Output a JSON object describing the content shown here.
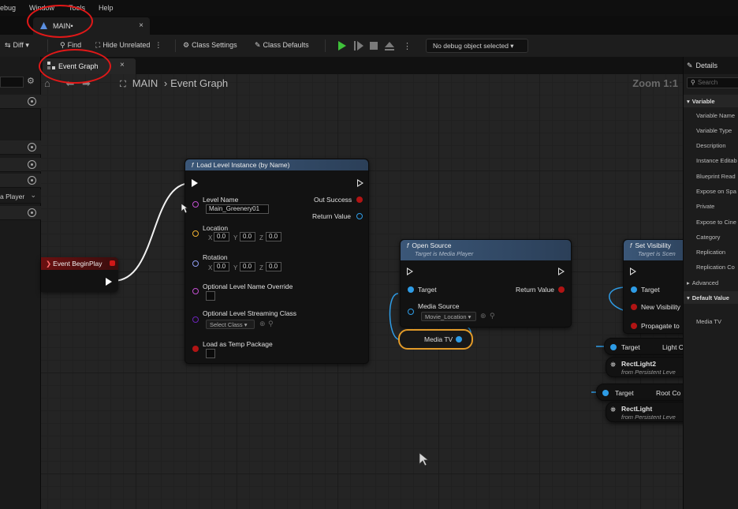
{
  "menu": {
    "items": [
      "ebug",
      "Window",
      "Tools",
      "Help"
    ]
  },
  "doc_tab": {
    "label": "MAIN•",
    "close": "×"
  },
  "toolbar": {
    "diff": "Diff ▾",
    "find": "Find",
    "hide_unrelated": "Hide Unrelated",
    "class_settings": "Class Settings",
    "class_defaults": "Class Defaults",
    "debug_select": "No debug object selected ▾"
  },
  "graph_tab": {
    "label": "Event Graph",
    "close": "×"
  },
  "breadcrumb": {
    "root": "MAIN",
    "separator": "›",
    "current": "Event Graph"
  },
  "zoom": "Zoom 1:1",
  "left_panel": {
    "partial_label": "a Player"
  },
  "event_node": {
    "title": "Event BeginPlay"
  },
  "load_level_node": {
    "title": "Load Level Instance (by Name)",
    "level_name_label": "Level Name",
    "level_name_value": "Main_Greenery01",
    "location_label": "Location",
    "rotation_label": "Rotation",
    "axis_x": "X",
    "axis_y": "Y",
    "axis_z": "Z",
    "loc_x": "0.0",
    "loc_y": "0.0",
    "loc_z": "0.0",
    "rot_x": "0.0",
    "rot_y": "0.0",
    "rot_z": "0.0",
    "override_label": "Optional Level Name Override",
    "streaming_label": "Optional Level Streaming Class",
    "streaming_value": "Select Class ▾",
    "temp_label": "Load as Temp Package",
    "out_success": "Out Success",
    "return_value": "Return Value"
  },
  "open_source_node": {
    "title": "Open Source",
    "subtitle": "Target is Media Player",
    "target": "Target",
    "media_source": "Media Source",
    "media_source_value": "Movie_Location ▾",
    "return_value": "Return Value"
  },
  "media_tv_var": {
    "label": "Media TV"
  },
  "set_visibility_node": {
    "title": "Set Visibility",
    "subtitle": "Target is Scen",
    "target": "Target",
    "new_visibility": "New Visibility",
    "propagate": "Propagate to"
  },
  "light_nodes": [
    {
      "target": "Target",
      "prop": "Light C",
      "name": "RectLight2",
      "from": "from Persistent Leve"
    },
    {
      "target": "Target",
      "prop": "Root Co",
      "name": "RectLight",
      "from": "from Persistent Leve"
    }
  ],
  "details": {
    "title": "Details",
    "search_placeholder": "Search",
    "variable_cat": "Variable",
    "rows": [
      "Variable Name",
      "Variable Type",
      "Description",
      "Instance Editab",
      "Blueprint Read",
      "Expose on Spa",
      "Private",
      "Expose to Cine",
      "Category",
      "Replication",
      "Replication Co"
    ],
    "advanced": "Advanced",
    "default_value_cat": "Default Value",
    "default_row": "Media TV"
  },
  "colors": {
    "node_header": "#3b5778",
    "event_header": "#6a1010",
    "annotation": "#e01818",
    "highlight": "#e29a28",
    "object_pin": "#2e9ce6",
    "name_pin": "#c34fd1",
    "vector_pin": "#f0b232",
    "rotator_pin": "#8f9cf2",
    "bool_pin": "#b11414",
    "class_pin": "#6b23b8",
    "play": "#3fc13a"
  }
}
